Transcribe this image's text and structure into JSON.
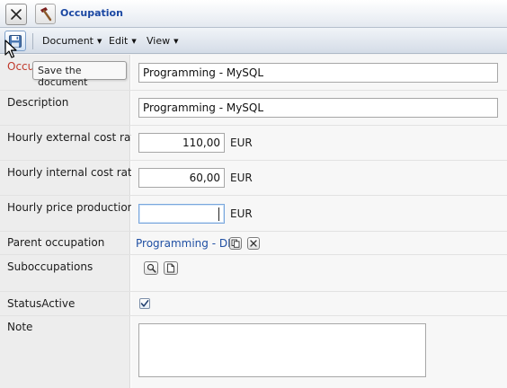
{
  "window": {
    "title": "Occupation",
    "close_icon": "close-icon",
    "app_icon": "hammer-icon"
  },
  "toolbar": {
    "save_icon": "floppy-disk-icon",
    "save_tooltip": "Save the document",
    "menus": [
      {
        "label": "Document"
      },
      {
        "label": "Edit"
      },
      {
        "label": "View"
      }
    ]
  },
  "form": {
    "occupation": {
      "label": "Occu",
      "value": "Programming - MySQL"
    },
    "description": {
      "label": "Description",
      "value": "Programming - MySQL"
    },
    "hourly_external": {
      "label": "Hourly external cost rate",
      "value": "110,00",
      "unit": "EUR"
    },
    "hourly_internal": {
      "label": "Hourly internal cost rate",
      "value": "60,00",
      "unit": "EUR"
    },
    "hourly_price": {
      "label": "Hourly price production",
      "value": "",
      "unit": "EUR"
    },
    "parent": {
      "label": "Parent occupation",
      "value": "Programming - DB",
      "copy_icon": "copy-icon",
      "clear_icon": "close-icon"
    },
    "suboccupations": {
      "label": "Suboccupations",
      "search_icon": "search-icon",
      "new_icon": "new-document-icon"
    },
    "status_active": {
      "label": "StatusActive",
      "checked": true
    },
    "note": {
      "label": "Note",
      "value": ""
    }
  },
  "colors": {
    "accent": "#1a47a2",
    "link": "#1f4fa3",
    "required_label": "#c0392b",
    "label_bg": "#ededed"
  }
}
